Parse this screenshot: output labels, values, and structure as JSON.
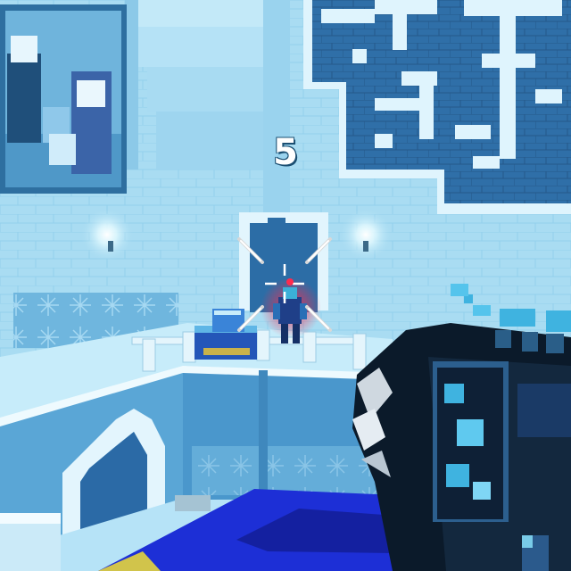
{
  "hud": {
    "counter": "5",
    "crosshair_icon": "crosshair-icon",
    "hitmarker_icon": "hit-marker-icon"
  },
  "colors": {
    "wall": "#a9dcf2",
    "wall_shadow": "#7cc2e4",
    "pattern_dark": "#2f6fa8",
    "pattern_light": "#dff4fd",
    "floor": "#bfe8f8",
    "enemy_highlight": "#ff2b4e",
    "weapon_dark": "#0b1a2a",
    "weapon_accent": "#3fb3e0",
    "foreground_block": "#1d2fd6"
  }
}
